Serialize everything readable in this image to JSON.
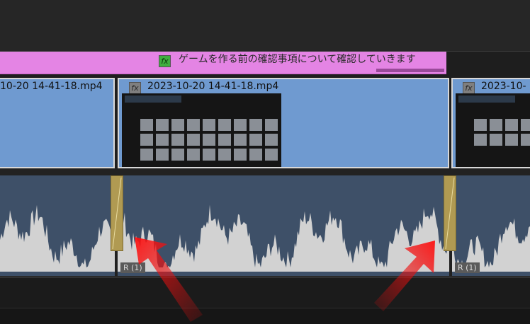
{
  "title_clip": {
    "text": "ゲームを作る前の確認事項について確認していきます",
    "fx": "fx"
  },
  "video_clips": [
    {
      "name": "10-20 14-41-18.mp4",
      "fx": ""
    },
    {
      "name": "2023-10-20 14-41-18.mp4",
      "fx": "fx"
    },
    {
      "name": "2023-10-",
      "fx": "fx"
    }
  ],
  "audio_clips": [
    {
      "label": ""
    },
    {
      "label": "R (1)"
    },
    {
      "label": "R (1)"
    }
  ],
  "colors": {
    "title_clip": "#e484e4",
    "video_clip": "#6f9ad0",
    "audio_clip": "#3e5068",
    "transition": "#b09a52",
    "arrow": "#e01010"
  },
  "icons": {
    "fx_badge": "fx-icon",
    "transition": "transition-marker-icon",
    "annotation": "red-arrow-icon"
  }
}
